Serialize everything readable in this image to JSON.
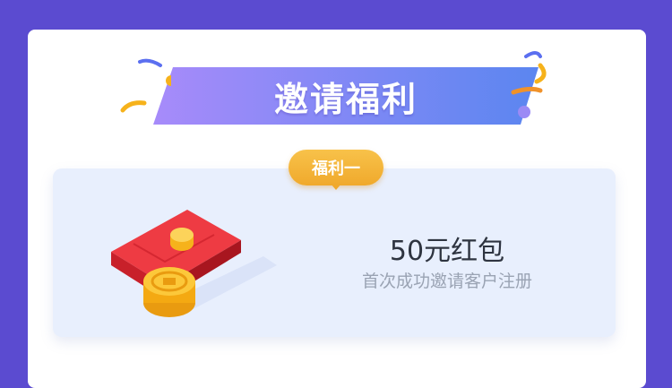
{
  "banner": {
    "title": "邀请福利"
  },
  "benefit": {
    "tag": "福利一",
    "amount": "50元红包",
    "description": "首次成功邀请客户注册"
  },
  "colors": {
    "background": "#5b4bd0",
    "banner_start": "#a78bfa",
    "banner_end": "#5b86f0",
    "tag": "#f0a92c",
    "box": "#e8effd",
    "envelope": "#e8303a",
    "coin": "#f6b21b"
  },
  "icons": [
    "red-envelope-icon",
    "gold-coin-icon",
    "confetti-icon"
  ]
}
